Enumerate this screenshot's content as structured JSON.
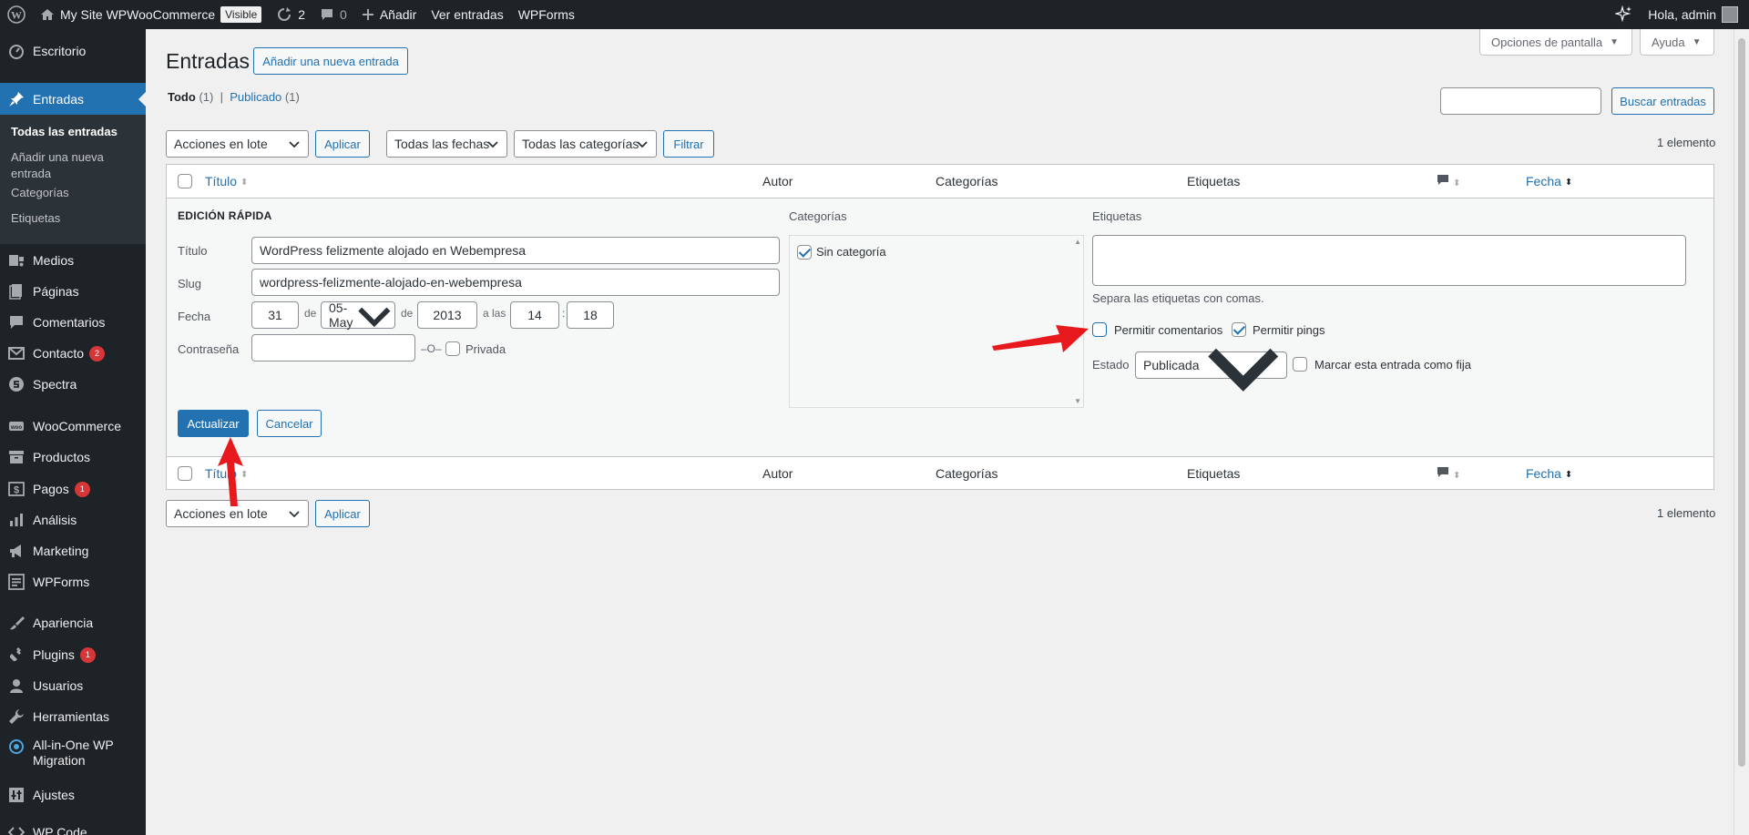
{
  "admin_bar": {
    "site_name": "My Site WPWooCommerce",
    "visibility_badge": "Visible",
    "updates_count": "2",
    "comments_count": "0",
    "new_label": "Añadir",
    "view_posts": "Ver entradas",
    "wpforms": "WPForms",
    "greeting": "Hola, admin"
  },
  "sidebar": {
    "dashboard": "Escritorio",
    "posts": "Entradas",
    "posts_sub": {
      "all": "Todas las entradas",
      "add_new": "Añadir una nueva entrada",
      "categories": "Categorías",
      "tags": "Etiquetas"
    },
    "media": "Medios",
    "pages": "Páginas",
    "comments": "Comentarios",
    "contact": "Contacto",
    "contact_badge": "2",
    "spectra": "Spectra",
    "woocommerce": "WooCommerce",
    "products": "Productos",
    "payments": "Pagos",
    "payments_badge": "1",
    "analytics": "Análisis",
    "marketing": "Marketing",
    "wpforms": "WPForms",
    "appearance": "Apariencia",
    "plugins": "Plugins",
    "plugins_badge": "1",
    "users": "Usuarios",
    "tools": "Herramientas",
    "migration": "All-in-One WP Migration",
    "settings": "Ajustes",
    "more": "WP Code"
  },
  "header": {
    "screen_options": "Opciones de pantalla",
    "help": "Ayuda",
    "title": "Entradas",
    "add_new_button": "Añadir una nueva entrada",
    "search_button": "Buscar entradas"
  },
  "views": {
    "all_label": "Todo",
    "all_count": "(1)",
    "sep": "|",
    "published_label": "Publicado",
    "published_count": "(1)"
  },
  "filters": {
    "bulk_actions": "Acciones en lote",
    "apply": "Aplicar",
    "all_dates": "Todas las fechas",
    "all_categories": "Todas las categorías",
    "filter": "Filtrar",
    "items_count": "1 elemento"
  },
  "table": {
    "col_title": "Título",
    "col_author": "Autor",
    "col_categories": "Categorías",
    "col_tags": "Etiquetas",
    "col_date": "Fecha"
  },
  "quick_edit": {
    "legend": "Edición rápida",
    "title_label": "Título",
    "title_value": "WordPress felizmente alojado en Webempresa",
    "slug_label": "Slug",
    "slug_value": "wordpress-felizmente-alojado-en-webempresa",
    "date_label": "Fecha",
    "day": "31",
    "de1": "de",
    "month": "05-May",
    "de2": "de",
    "year": "2013",
    "at": "a las",
    "hour": "14",
    "colon": ":",
    "minute": "18",
    "password_label": "Contraseña",
    "or": "–O–",
    "private_label": "Privada",
    "categories_label": "Categorías",
    "category_item": "Sin categoría",
    "tags_label": "Etiquetas",
    "tags_hint": "Separa las etiquetas con comas.",
    "allow_comments": "Permitir comentarios",
    "allow_pings": "Permitir pings",
    "status_label": "Estado",
    "status_value": "Publicada",
    "sticky_label": "Marcar esta entrada como fija",
    "update_button": "Actualizar",
    "cancel_button": "Cancelar"
  },
  "colors": {
    "accent": "#2271b1",
    "sidebar_bg": "#1d2327",
    "annotation_arrow": "#e8191c"
  }
}
